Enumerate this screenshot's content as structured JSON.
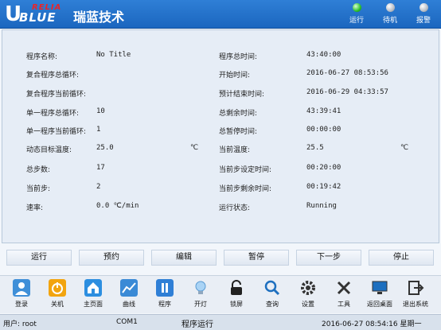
{
  "header": {
    "logo_mark": "U",
    "logo_relia": "RELIA",
    "logo_blue": "BLUE",
    "company_name": "瑞蓝技术",
    "indicators": [
      {
        "label": "运行",
        "state": "on",
        "color": "#2bbf2b"
      },
      {
        "label": "待机",
        "state": "off",
        "color": "#b9bec6"
      },
      {
        "label": "报警",
        "state": "off",
        "color": "#b9bec6"
      }
    ]
  },
  "left_fields": [
    {
      "label": "程序名称:",
      "value": "No Title"
    },
    {
      "label": "复合程序总循环:",
      "value": ""
    },
    {
      "label": "复合程序当前循环:",
      "value": ""
    },
    {
      "label": "单一程序总循环:",
      "value": "10"
    },
    {
      "label": "单一程序当前循环:",
      "value": "1"
    },
    {
      "label": "动态目标温度:",
      "value": "25.0",
      "unit": "℃"
    },
    {
      "label": "总步数:",
      "value": "17"
    },
    {
      "label": "当前步:",
      "value": "2"
    },
    {
      "label": "速率:",
      "value": "0.0 ℃/min"
    }
  ],
  "right_fields": [
    {
      "label": "程序总时间:",
      "value": "43:40:00"
    },
    {
      "label": "开始时间:",
      "value": "2016-06-27 08:53:56"
    },
    {
      "label": "预计结束时间:",
      "value": "2016-06-29 04:33:57"
    },
    {
      "label": "总剩余时间:",
      "value": "43:39:41"
    },
    {
      "label": "总暂停时间:",
      "value": "00:00:00"
    },
    {
      "label": "当前温度:",
      "value": "25.5",
      "unit": "℃"
    },
    {
      "label": "当前步设定时间:",
      "value": "00:20:00"
    },
    {
      "label": "当前步剩余时间:",
      "value": "00:19:42"
    },
    {
      "label": "运行状态:",
      "value": "Running"
    }
  ],
  "actions": [
    "运行",
    "预约",
    "编辑",
    "暂停",
    "下一步",
    "停止"
  ],
  "toolbar": [
    {
      "label": "登录",
      "icon": "user-login-icon"
    },
    {
      "label": "关机",
      "icon": "power-icon"
    },
    {
      "label": "主页面",
      "icon": "home-icon"
    },
    {
      "label": "曲线",
      "icon": "chart-icon"
    },
    {
      "label": "程序",
      "icon": "program-icon"
    },
    {
      "label": "开灯",
      "icon": "lightbulb-icon"
    },
    {
      "label": "锁屏",
      "icon": "lock-icon"
    },
    {
      "label": "查询",
      "icon": "search-icon"
    },
    {
      "label": "设置",
      "icon": "gear-icon"
    },
    {
      "label": "工具",
      "icon": "tools-icon"
    },
    {
      "label": "返回桌面",
      "icon": "desktop-icon"
    },
    {
      "label": "退出系统",
      "icon": "exit-icon"
    }
  ],
  "statusbar": {
    "user": "用户: root",
    "port": "COM1",
    "mode": "程序运行",
    "datetime": "2016-06-27 08:54:16 星期一"
  },
  "colors": {
    "header": "#1b66bf",
    "indicator_on": "#2bbf2b",
    "panel": "#e6edf6"
  }
}
